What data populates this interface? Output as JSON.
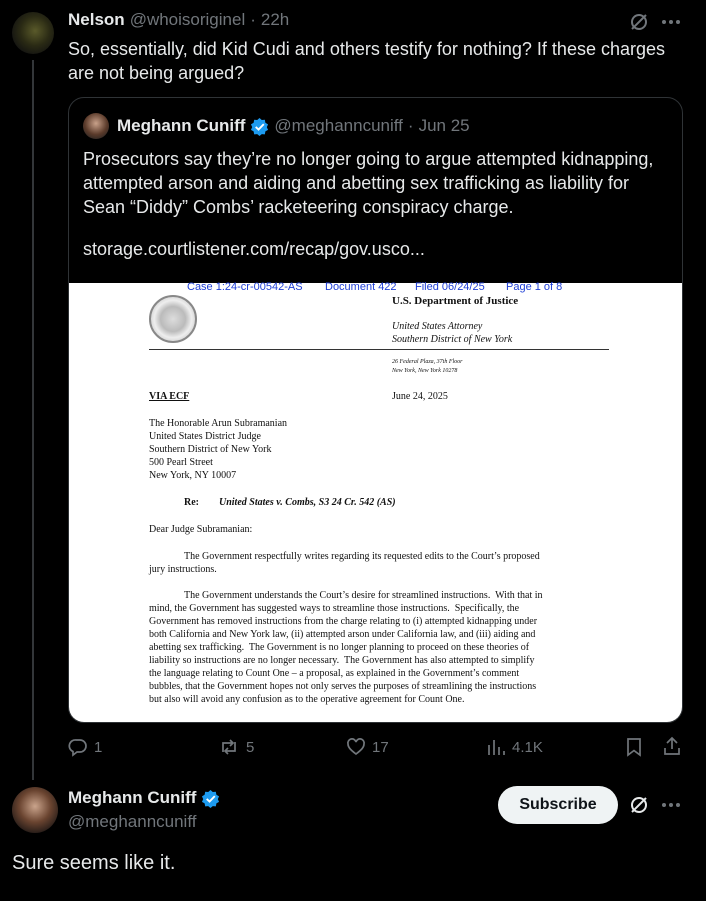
{
  "reply": {
    "name": "Nelson",
    "handle": "@whoisoriginel",
    "time": "22h",
    "text": "So, essentially, did Kid Cudi and others testify for nothing? If these charges are not being argued?"
  },
  "quoted": {
    "name": "Meghann Cuniff",
    "handle": "@meghanncuniff",
    "date": "Jun 25",
    "text": "Prosecutors say they’re no longer going to argue attempted kidnapping, attempted arson and aiding and abetting sex trafficking as liability for Sean “Diddy” Combs’ racketeering conspiracy charge.",
    "link": "storage.courtlistener.com/recap/gov.usco..."
  },
  "document": {
    "header_case": "Case 1:24-cr-00542-AS",
    "header_doc": "Document 422",
    "header_filed": "Filed 06/24/25",
    "header_page": "Page 1 of 8",
    "dept": "U.S. Department of Justice",
    "office1": "United States Attorney",
    "office2": "Southern District of New York",
    "addr1": "26 Federal Plaza, 37th Floor",
    "addr2": "New York, New York 10278",
    "via": "VIA ECF",
    "date": "June 24, 2025",
    "recipient": [
      "The Honorable Arun Subramanian",
      "United States District Judge",
      "Southern District of New York",
      "500 Pearl Street",
      "New York, NY 10007"
    ],
    "re_label": "Re:",
    "re_text": "United States v. Combs, S3 24 Cr. 542 (AS)",
    "salutation": "Dear Judge Subramanian:",
    "para1": [
      "The Government respectfully writes regarding its requested edits to the Court’s proposed",
      "jury instructions."
    ],
    "para2": [
      "The Government understands the Court’s desire for streamlined instructions.  With that in",
      "mind, the Government has suggested ways to streamline those instructions.  Specifically, the",
      "Government has removed instructions from the charge relating to (i) attempted kidnapping under",
      "both California and New York law, (ii) attempted arson under California law, and (iii) aiding and",
      "abetting sex trafficking.  The Government is no longer planning to proceed on these theories of",
      "liability so instructions are no longer necessary.  The Government has also attempted to simplify",
      "the language relating to Count One – a proposal, as explained in the Government’s comment",
      "bubbles, that the Government hopes not only serves the purposes of streamlining the instructions",
      "but also will avoid any confusion as to the operative agreement for Count One."
    ]
  },
  "actions": {
    "replies": "1",
    "reposts": "5",
    "likes": "17",
    "views": "4.1K"
  },
  "main": {
    "name": "Meghann Cuniff",
    "handle": "@meghanncuniff",
    "subscribe_label": "Subscribe",
    "text": "Sure seems like it."
  },
  "colors": {
    "verified": "#1d9bf0",
    "doc_header": "#1f3fd6"
  }
}
